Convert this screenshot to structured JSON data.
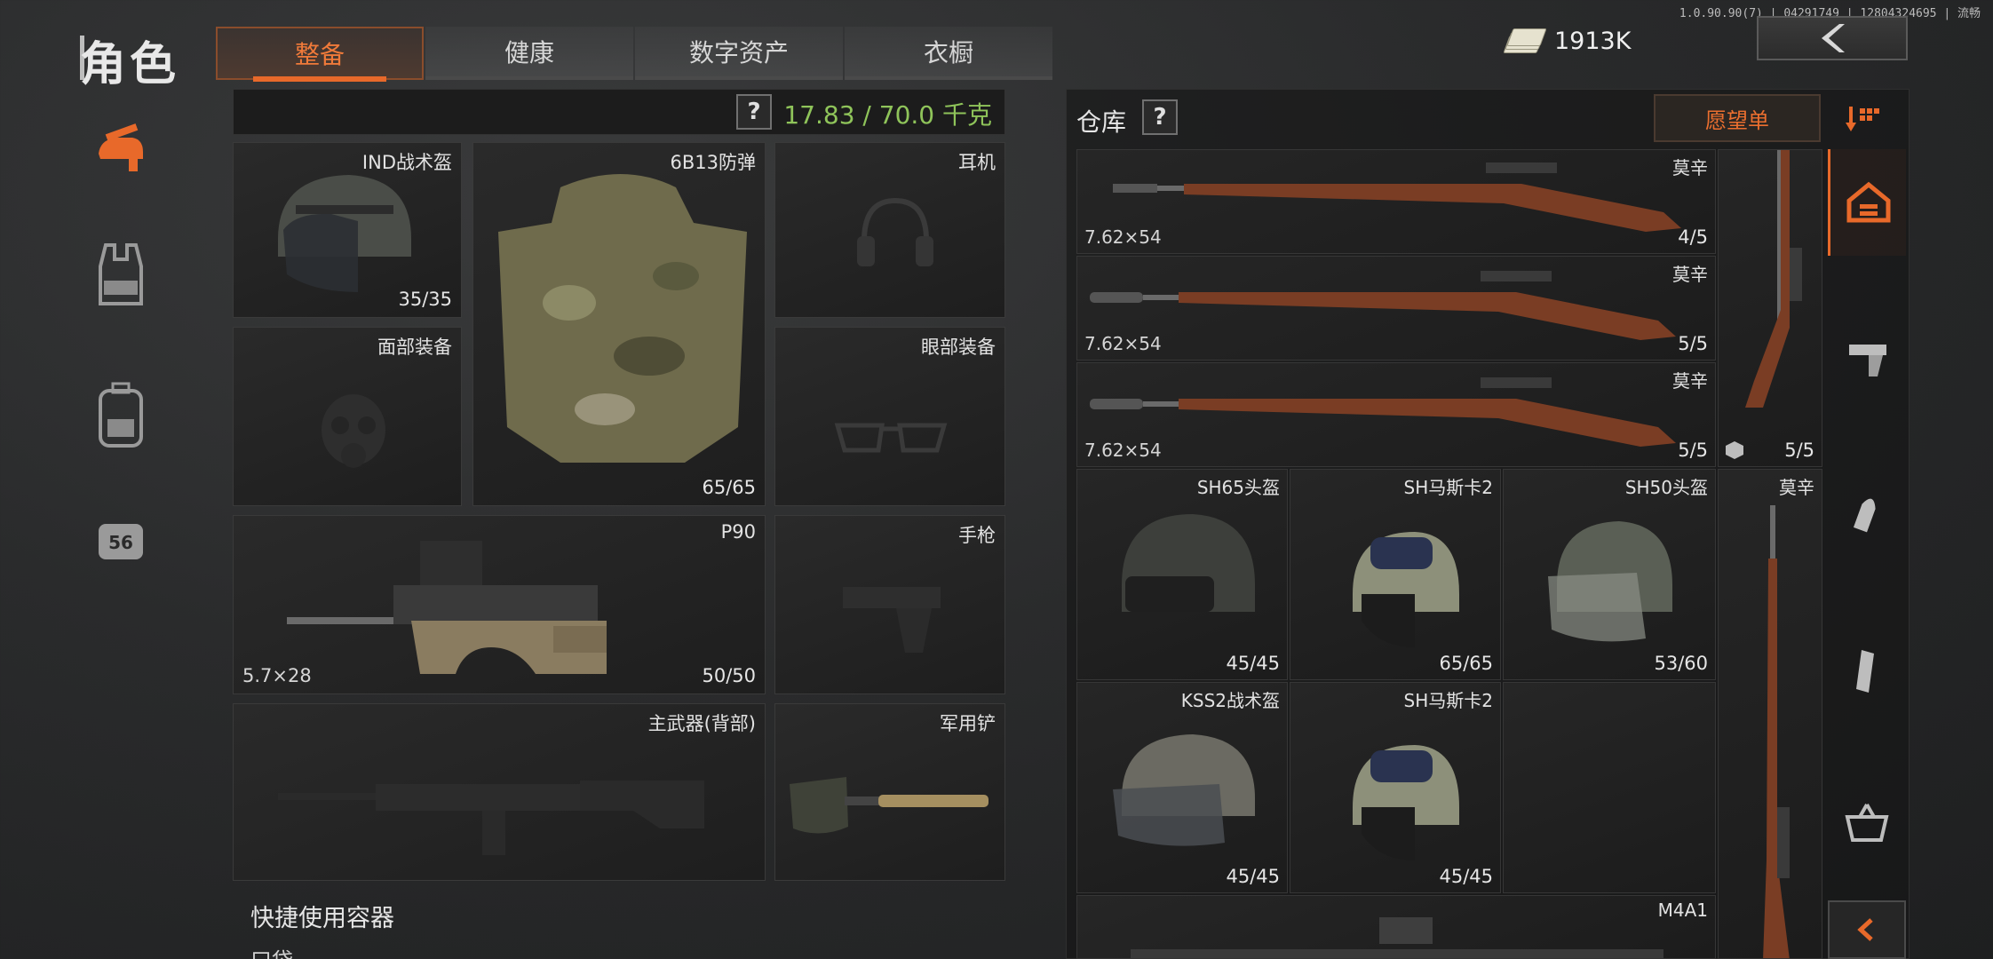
{
  "header": {
    "title": "角色",
    "version": "1.0.90.90(7) | 04291749 | 12804324695 | 流畅",
    "tabs": [
      {
        "label": "整备",
        "active": true
      },
      {
        "label": "健康",
        "active": false
      },
      {
        "label": "数字资产",
        "active": false
      },
      {
        "label": "衣橱",
        "active": false
      }
    ],
    "currency": "1913K",
    "back_icon": "chevron-left-icon"
  },
  "sidebar": {
    "items": [
      {
        "icon": "gun-helmet-icon",
        "active": true
      },
      {
        "icon": "vest-icon",
        "active": false
      },
      {
        "icon": "backpack-icon",
        "active": false
      },
      {
        "icon": "pouch-icon",
        "label": "56",
        "active": false
      }
    ]
  },
  "equipment": {
    "help": "?",
    "weight": "17.83 / 70.0 千克",
    "slots": {
      "helmet": {
        "label": "IND战术盔",
        "count": "35/35"
      },
      "armor": {
        "label": "6B13防弹",
        "count": "65/65"
      },
      "headset": {
        "label": "耳机"
      },
      "face": {
        "label": "面部装备"
      },
      "eyewear": {
        "label": "眼部装备"
      },
      "primary": {
        "label": "P90",
        "ammo": "5.7×28",
        "count": "50/50"
      },
      "pistol": {
        "label": "手枪"
      },
      "secondary": {
        "label": "主武器(背部)"
      },
      "melee": {
        "label": "军用铲"
      }
    },
    "quick_container": {
      "title": "快捷使用容器",
      "sub": "口袋"
    }
  },
  "warehouse": {
    "title": "仓库",
    "help": "?",
    "wishlist": "愿望单",
    "items": [
      {
        "name": "莫辛",
        "ammo": "7.62×54",
        "count": "4/5"
      },
      {
        "name": "莫辛",
        "ammo": "7.62×54",
        "count": "5/5"
      },
      {
        "name": "莫辛",
        "ammo": "7.62×54",
        "count": "5/5"
      },
      {
        "name": "莫辛",
        "count": "5/5"
      },
      {
        "name": "SH65头盔",
        "count": "45/45"
      },
      {
        "name": "SH马斯卡2",
        "count": "65/65"
      },
      {
        "name": "SH50头盔",
        "count": "53/60"
      },
      {
        "name": "莫辛"
      },
      {
        "name": "KSS2战术盔",
        "count": "45/45"
      },
      {
        "name": "SH马斯卡2",
        "count": "45/45"
      },
      {
        "name": "M4A1"
      }
    ],
    "categories": [
      "home-icon",
      "pistol-icon",
      "ammo-icon",
      "magazine-icon",
      "basket-icon"
    ],
    "collapse_icon": "chevron-left-icon"
  },
  "colors": {
    "accent": "#e8692a",
    "weight_green": "#8fc45a",
    "panel": "#1e1e1e"
  }
}
